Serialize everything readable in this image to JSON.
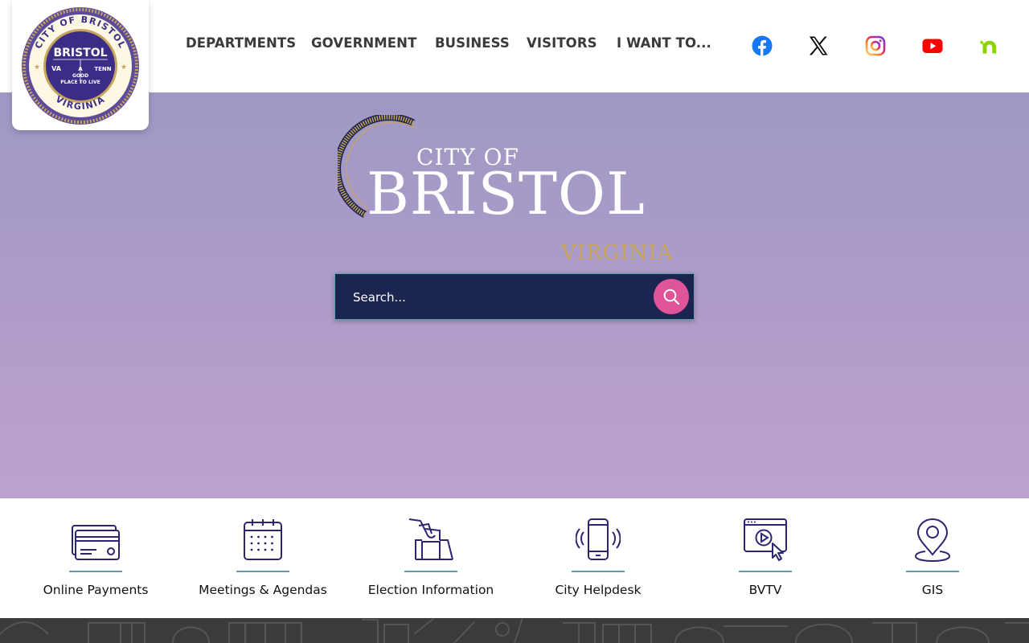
{
  "header": {
    "seal": {
      "ring_text_top": "CITY OF BRISTOL",
      "ring_text_bottom": "VIRGINIA",
      "center_title": "BRISTOL",
      "left_state": "VA",
      "right_state": "TENN",
      "motto_a": "A",
      "motto_good": "GOOD",
      "motto_line": "PLACE TO LIVE"
    },
    "nav": [
      {
        "label": "DEPARTMENTS"
      },
      {
        "label": "GOVERNMENT"
      },
      {
        "label": "BUSINESS"
      },
      {
        "label": "VISITORS"
      },
      {
        "label": "I WANT TO..."
      }
    ],
    "social": [
      {
        "name": "facebook-icon",
        "color": "#1877f2"
      },
      {
        "name": "x-twitter-icon",
        "color": "#000000"
      },
      {
        "name": "instagram-icon",
        "color": "#d6249f"
      },
      {
        "name": "youtube-icon",
        "color": "#ff0000"
      },
      {
        "name": "nextdoor-icon",
        "color": "#8ed500"
      }
    ]
  },
  "hero": {
    "logo": {
      "city_of": "CITY OF",
      "name": "BRISTOL",
      "state": "VIRGINIA"
    },
    "search": {
      "placeholder": "Search..."
    },
    "colors": {
      "search_bg": "#1c2550",
      "search_button": "#e0559a",
      "accent_teal": "#5aa3a8",
      "gold": "#c8a55d"
    }
  },
  "quick_links": [
    {
      "label": "Online Payments",
      "icon": "credit-card-icon"
    },
    {
      "label": "Meetings & Agendas",
      "icon": "calendar-icon"
    },
    {
      "label": "Election Information",
      "icon": "ballot-box-icon"
    },
    {
      "label": "City Helpdesk",
      "icon": "mobile-phone-icon"
    },
    {
      "label": "BVTV",
      "icon": "video-player-icon"
    },
    {
      "label": "GIS",
      "icon": "map-pin-icon"
    }
  ]
}
